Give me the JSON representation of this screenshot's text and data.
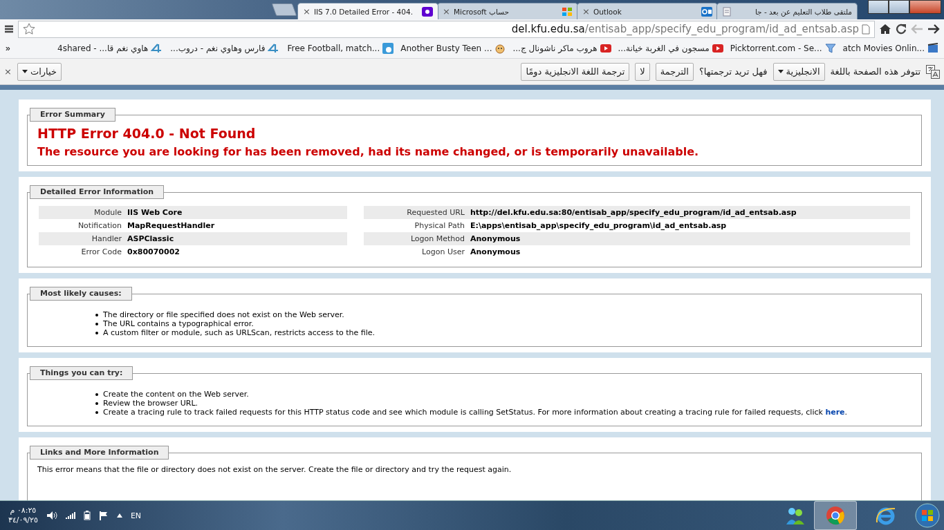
{
  "browser": {
    "tabs": [
      {
        "title": "IIS 7.0 Detailed Error - 404.",
        "kind": "yahoo",
        "close": "×",
        "selected": true
      },
      {
        "title": "Microsoft حساب",
        "kind": "windows",
        "close": "×",
        "selected": false
      },
      {
        "title": "Outlook",
        "kind": "outlook",
        "close": "×",
        "selected": false
      },
      {
        "title": "ملتقى طلاب التعليم عن بعد - جا",
        "kind": "page",
        "selected": false
      }
    ],
    "address": {
      "host": "del.kfu.edu.sa",
      "path": "/entisab_app/specify_edu_program/id_ad_entsab.asp"
    },
    "bookmarks_more": "»",
    "bookmarks": [
      {
        "title": "هاوي نغم قا... - 4shared",
        "kind": "fourshared"
      },
      {
        "title": "فارس وهاوي نغم - دروب...",
        "kind": "fourshared"
      },
      {
        "title": "Free Football, match...",
        "kind": "ball"
      },
      {
        "title": "Another Busty Teen ...",
        "kind": "face"
      },
      {
        "title": "هروب ماكر ناشونال ج...",
        "kind": "youtube"
      },
      {
        "title": "مسجون في الغربة خيانة...",
        "kind": "youtube"
      },
      {
        "title": "Picktorrent.com - Se...",
        "kind": "funnel"
      },
      {
        "title": "atch Movies Onlin...",
        "kind": "film"
      }
    ],
    "translate": {
      "message": "تتوفر هذه الصفحة باللغة",
      "language": "الانجليزية",
      "question": "فهل تريد ترجمتها؟",
      "translate_button": "الترجمة",
      "no_button": "لا",
      "always_button": "ترجمة اللغة الانجليزية دومًا",
      "options_button": "خيارات",
      "close": "×"
    }
  },
  "page": {
    "summary": {
      "legend": "Error Summary",
      "heading": "HTTP Error 404.0 - Not Found",
      "message": "The resource you are looking for has been removed, had its name changed, or is temporarily unavailable."
    },
    "details": {
      "legend": "Detailed Error Information",
      "left": [
        {
          "label": "Module",
          "value": "IIS Web Core"
        },
        {
          "label": "Notification",
          "value": "MapRequestHandler"
        },
        {
          "label": "Handler",
          "value": "ASPClassic"
        },
        {
          "label": "Error Code",
          "value": "0x80070002"
        }
      ],
      "right": [
        {
          "label": "Requested URL",
          "value": "http://del.kfu.edu.sa:80/entisab_app/specify_edu_program/id_ad_entsab.asp"
        },
        {
          "label": "Physical Path",
          "value": "E:\\apps\\entisab_app\\specify_edu_program\\id_ad_entsab.asp"
        },
        {
          "label": "Logon Method",
          "value": "Anonymous"
        },
        {
          "label": "Logon User",
          "value": "Anonymous"
        }
      ]
    },
    "causes": {
      "legend": "Most likely causes:",
      "items": [
        {
          "text": "The directory or file specified does not exist on the Web server."
        },
        {
          "text": "The URL contains a typographical error."
        },
        {
          "text": "A custom filter or module, such as URLScan, restricts access to the file."
        }
      ]
    },
    "things": {
      "legend": "Things you can try:",
      "items": [
        {
          "text": "Create the content on the Web server."
        },
        {
          "text": "Review the browser URL."
        },
        {
          "text": "Create a tracing rule to track failed requests for this HTTP status code and see which module is calling SetStatus. For more information about creating a tracing rule for failed requests, click ",
          "link": "here",
          "after": "."
        }
      ]
    },
    "links": {
      "legend": "Links and More Information",
      "text": "This error means that the file or directory does not exist on the server. Create the file or directory and try the request again."
    }
  },
  "taskbar": {
    "time": "٠٨:٢٥ م",
    "date": "٣٤/٠٩/٢٥",
    "language": "EN"
  }
}
